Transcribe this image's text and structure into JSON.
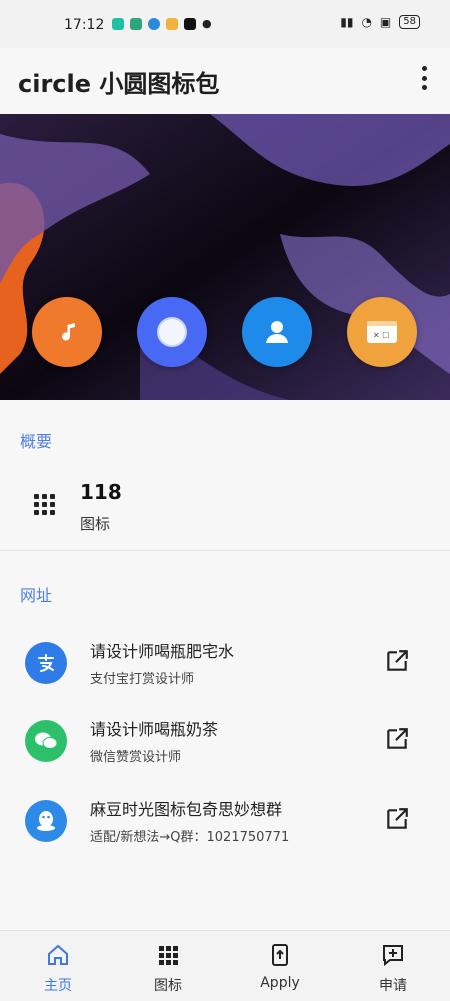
{
  "status_bar": {
    "time": "17:12",
    "battery": "58"
  },
  "header": {
    "title": "circle 小圆图标包"
  },
  "hero": {
    "icons": [
      "music-note-icon",
      "circle-icon",
      "person-icon",
      "browser-window-icon"
    ],
    "colors": [
      "#ef7a2b",
      "#4869f3",
      "#1e8bea",
      "#f0a23d"
    ]
  },
  "overview": {
    "section_label": "概要",
    "count": "118",
    "count_label": "图标"
  },
  "links": {
    "section_label": "网址",
    "items": [
      {
        "title": "请设计师喝瓶肥宅水",
        "subtitle": "支付宝打赏设计师",
        "icon": "alipay-icon",
        "color": "#2f7be7"
      },
      {
        "title": "请设计师喝瓶奶茶",
        "subtitle": "微信赞赏设计师",
        "icon": "wechat-icon",
        "color": "#2dc06a"
      },
      {
        "title": "麻豆时光图标包奇思妙想群",
        "subtitle": "适配/新想法→Q群：1021750771",
        "icon": "qq-icon",
        "color": "#2d8be7"
      }
    ]
  },
  "bottom_nav": {
    "items": [
      {
        "label": "主页",
        "icon": "home-icon"
      },
      {
        "label": "图标",
        "icon": "grid-icon"
      },
      {
        "label": "Apply",
        "icon": "apply-icon"
      },
      {
        "label": "申请",
        "icon": "request-icon"
      }
    ]
  }
}
